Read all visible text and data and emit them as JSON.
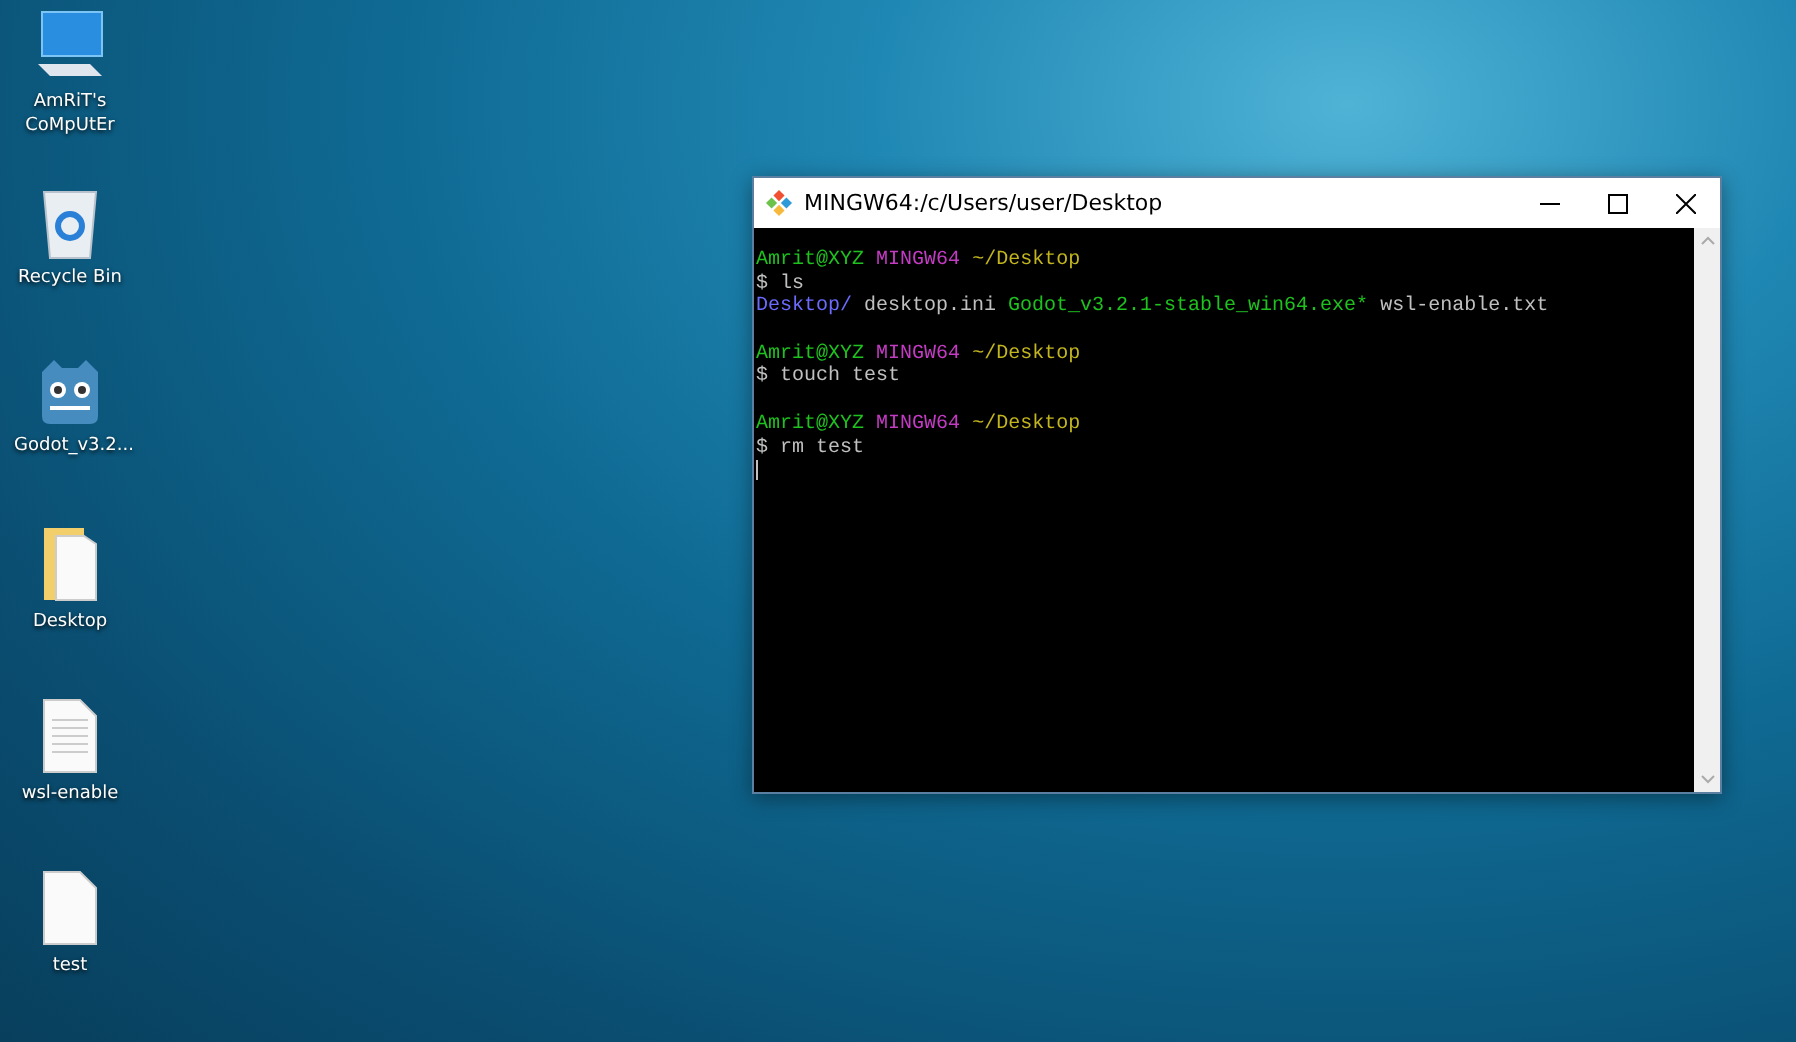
{
  "desktop_icons": [
    {
      "kind": "computer",
      "label": "AmRiT's CoMpUtEr"
    },
    {
      "kind": "recycle",
      "label": "Recycle Bin"
    },
    {
      "kind": "godot",
      "label": "Godot_v3.2..."
    },
    {
      "kind": "folder",
      "label": "Desktop"
    },
    {
      "kind": "textfile",
      "label": "wsl-enable"
    },
    {
      "kind": "file",
      "label": "test"
    }
  ],
  "window": {
    "title": "MINGW64:/c/Users/user/Desktop",
    "lines": [
      {
        "kind": "text",
        "segments": [
          {
            "kind": "user",
            "text": "Amrit@XYZ"
          },
          {
            "kind": "host",
            "text": "MINGW64"
          },
          {
            "kind": "path",
            "text": "~/Desktop"
          }
        ]
      },
      {
        "kind": "text",
        "segments": [
          {
            "kind": "plain",
            "text": "$ ls"
          }
        ]
      },
      {
        "kind": "text",
        "segments": [
          {
            "kind": "dir",
            "text": "Desktop/"
          },
          {
            "kind": "plain",
            "text": " desktop.ini "
          },
          {
            "kind": "exe",
            "text": "Godot_v3.2.1-stable_win64.exe*"
          },
          {
            "kind": "plain",
            "text": " wsl-enable.txt"
          }
        ]
      },
      {
        "kind": "blank"
      },
      {
        "kind": "text",
        "segments": [
          {
            "kind": "user",
            "text": "Amrit@XYZ"
          },
          {
            "kind": "host",
            "text": "MINGW64"
          },
          {
            "kind": "path",
            "text": "~/Desktop"
          }
        ]
      },
      {
        "kind": "text",
        "segments": [
          {
            "kind": "plain",
            "text": "$ touch test"
          }
        ]
      },
      {
        "kind": "blank"
      },
      {
        "kind": "text",
        "segments": [
          {
            "kind": "user",
            "text": "Amrit@XYZ"
          },
          {
            "kind": "host",
            "text": "MINGW64"
          },
          {
            "kind": "path",
            "text": "~/Desktop"
          }
        ]
      },
      {
        "kind": "text",
        "segments": [
          {
            "kind": "plain",
            "text": "$ rm test"
          }
        ]
      },
      {
        "kind": "cursor"
      }
    ]
  }
}
